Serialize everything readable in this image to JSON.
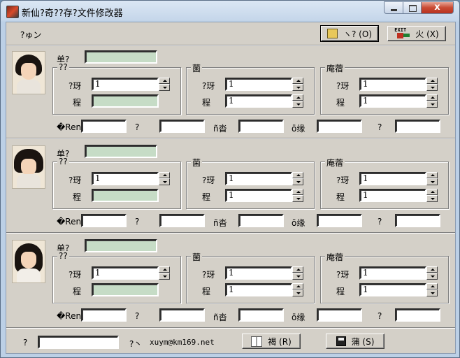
{
  "window": {
    "title": "新仙?奇??存?文件修改器",
    "minimize_label": "",
    "maximize_label": "",
    "close_label": "x"
  },
  "toolbar": {
    "caption": "?ゅン",
    "open_label": "ヽ? (O)",
    "exit_label": "火  (X)",
    "exit_icon_text": "EXIT"
  },
  "labels": {
    "name": "单?",
    "group_a": "??",
    "group_b": "菌",
    "group_c": "庵蓿",
    "spin_label": "?玡",
    "field_label": "程",
    "stat_1": "�René?",
    "stat_2": "?",
    "stat_3": "ñ沓",
    "stat_4": "ō缘",
    "stat_5": "?"
  },
  "characters": [
    {
      "name_value": "",
      "a_spin": "1",
      "a_field": "",
      "b_spin": "1",
      "b_field": "1",
      "c_spin": "1",
      "c_field": "1",
      "stats": [
        "",
        "",
        "",
        "",
        ""
      ]
    },
    {
      "name_value": "",
      "a_spin": "1",
      "a_field": "",
      "b_spin": "1",
      "b_field": "1",
      "c_spin": "1",
      "c_field": "1",
      "stats": [
        "",
        "",
        "",
        "",
        ""
      ]
    },
    {
      "name_value": "",
      "a_spin": "1",
      "a_field": "",
      "b_spin": "1",
      "b_field": "1",
      "c_spin": "1",
      "c_field": "1",
      "stats": [
        "",
        "",
        "",
        "",
        ""
      ]
    }
  ],
  "footer": {
    "left_label": "?",
    "left_value": "",
    "mid_label": "?丶",
    "email": "xuym@km169.net",
    "help_label": "褐 (R)",
    "save_label": "蒲  (S)"
  },
  "icons": [
    "app-icon",
    "open-folder-icon",
    "exit-icon",
    "portrait-1",
    "portrait-2",
    "portrait-3",
    "book-icon",
    "floppy-icon"
  ]
}
